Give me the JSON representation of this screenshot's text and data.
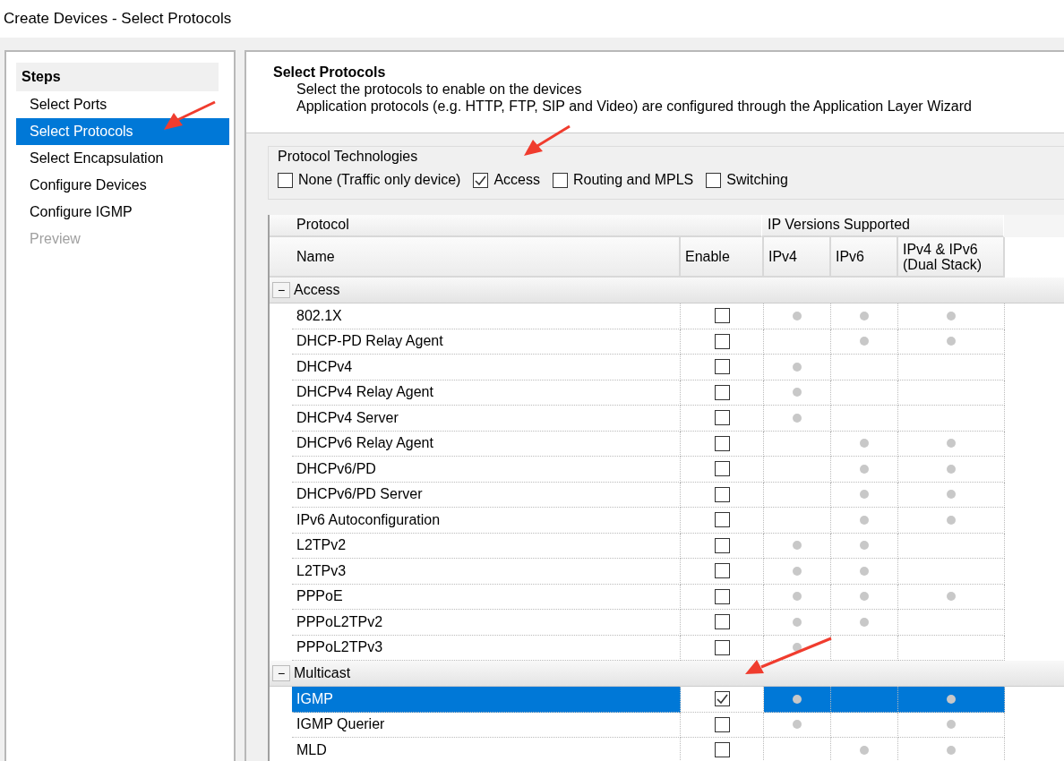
{
  "window": {
    "title": "Create Devices - Select Protocols"
  },
  "steps": {
    "title": "Steps",
    "items": [
      {
        "label": "Select Ports",
        "selected": false,
        "disabled": false
      },
      {
        "label": "Select Protocols",
        "selected": true,
        "disabled": false
      },
      {
        "label": "Select Encapsulation",
        "selected": false,
        "disabled": false
      },
      {
        "label": "Configure Devices",
        "selected": false,
        "disabled": false
      },
      {
        "label": "Configure IGMP",
        "selected": false,
        "disabled": false
      },
      {
        "label": "Preview",
        "selected": false,
        "disabled": true
      }
    ]
  },
  "header": {
    "title": "Select Protocols",
    "lines": [
      "Select the protocols to enable on the devices",
      "Application protocols (e.g. HTTP, FTP, SIP and Video) are configured through the Application Layer Wizard"
    ]
  },
  "technologies": {
    "title": "Protocol Technologies",
    "options": [
      {
        "label": "None (Traffic only device)",
        "checked": false
      },
      {
        "label": "Access",
        "checked": true
      },
      {
        "label": "Routing and MPLS",
        "checked": false
      },
      {
        "label": "Switching",
        "checked": false
      }
    ]
  },
  "grid": {
    "group_headers": [
      "Protocol",
      "IP Versions Supported"
    ],
    "columns": [
      "Name",
      "Enable",
      "IPv4",
      "IPv6",
      "IPv4 & IPv6\n(Dual Stack)"
    ],
    "groups": [
      {
        "name": "Access",
        "expander": "−",
        "rows": [
          {
            "name": "802.1X",
            "enabled": false,
            "selected": false,
            "ipv4": true,
            "ipv6": true,
            "dual": true
          },
          {
            "name": "DHCP-PD Relay Agent",
            "enabled": false,
            "selected": false,
            "ipv4": false,
            "ipv6": true,
            "dual": true
          },
          {
            "name": "DHCPv4",
            "enabled": false,
            "selected": false,
            "ipv4": true,
            "ipv6": false,
            "dual": false
          },
          {
            "name": "DHCPv4 Relay Agent",
            "enabled": false,
            "selected": false,
            "ipv4": true,
            "ipv6": false,
            "dual": false
          },
          {
            "name": "DHCPv4 Server",
            "enabled": false,
            "selected": false,
            "ipv4": true,
            "ipv6": false,
            "dual": false
          },
          {
            "name": "DHCPv6 Relay Agent",
            "enabled": false,
            "selected": false,
            "ipv4": false,
            "ipv6": true,
            "dual": true
          },
          {
            "name": "DHCPv6/PD",
            "enabled": false,
            "selected": false,
            "ipv4": false,
            "ipv6": true,
            "dual": true
          },
          {
            "name": "DHCPv6/PD Server",
            "enabled": false,
            "selected": false,
            "ipv4": false,
            "ipv6": true,
            "dual": true
          },
          {
            "name": "IPv6 Autoconfiguration",
            "enabled": false,
            "selected": false,
            "ipv4": false,
            "ipv6": true,
            "dual": true
          },
          {
            "name": "L2TPv2",
            "enabled": false,
            "selected": false,
            "ipv4": true,
            "ipv6": true,
            "dual": false
          },
          {
            "name": "L2TPv3",
            "enabled": false,
            "selected": false,
            "ipv4": true,
            "ipv6": true,
            "dual": false
          },
          {
            "name": "PPPoE",
            "enabled": false,
            "selected": false,
            "ipv4": true,
            "ipv6": true,
            "dual": true
          },
          {
            "name": "PPPoL2TPv2",
            "enabled": false,
            "selected": false,
            "ipv4": true,
            "ipv6": true,
            "dual": false
          },
          {
            "name": "PPPoL2TPv3",
            "enabled": false,
            "selected": false,
            "ipv4": true,
            "ipv6": false,
            "dual": false
          }
        ]
      },
      {
        "name": "Multicast",
        "expander": "−",
        "rows": [
          {
            "name": "IGMP",
            "enabled": true,
            "selected": true,
            "ipv4": true,
            "ipv6": false,
            "dual": true
          },
          {
            "name": "IGMP Querier",
            "enabled": false,
            "selected": false,
            "ipv4": true,
            "ipv6": false,
            "dual": true
          },
          {
            "name": "MLD",
            "enabled": false,
            "selected": false,
            "ipv4": false,
            "ipv6": true,
            "dual": true
          }
        ]
      }
    ]
  }
}
